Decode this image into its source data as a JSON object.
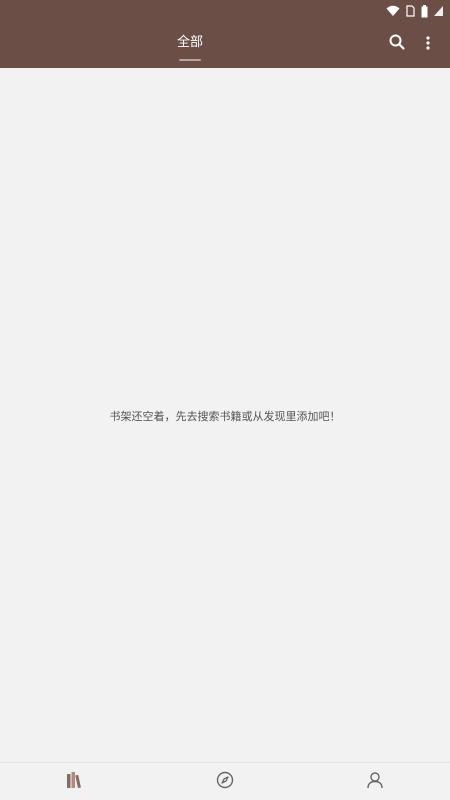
{
  "status_bar": {
    "icons": [
      "wifi-icon",
      "sim-icon",
      "battery-icon",
      "signal-icon"
    ]
  },
  "app_bar": {
    "tabs": [
      {
        "label": "全部",
        "selected": true
      }
    ],
    "actions": [
      "search-icon",
      "more-vert-icon"
    ],
    "background_color": "#6b4f47"
  },
  "content": {
    "empty_message": "书架还空着，先去搜索书籍或从发现里添加吧！"
  },
  "bottom_nav": {
    "items": [
      {
        "icon": "bookshelf-icon",
        "selected": true
      },
      {
        "icon": "compass-icon",
        "selected": false
      },
      {
        "icon": "person-icon",
        "selected": false
      }
    ],
    "selected_color": "#8a6b63",
    "unselected_color": "#666666"
  }
}
